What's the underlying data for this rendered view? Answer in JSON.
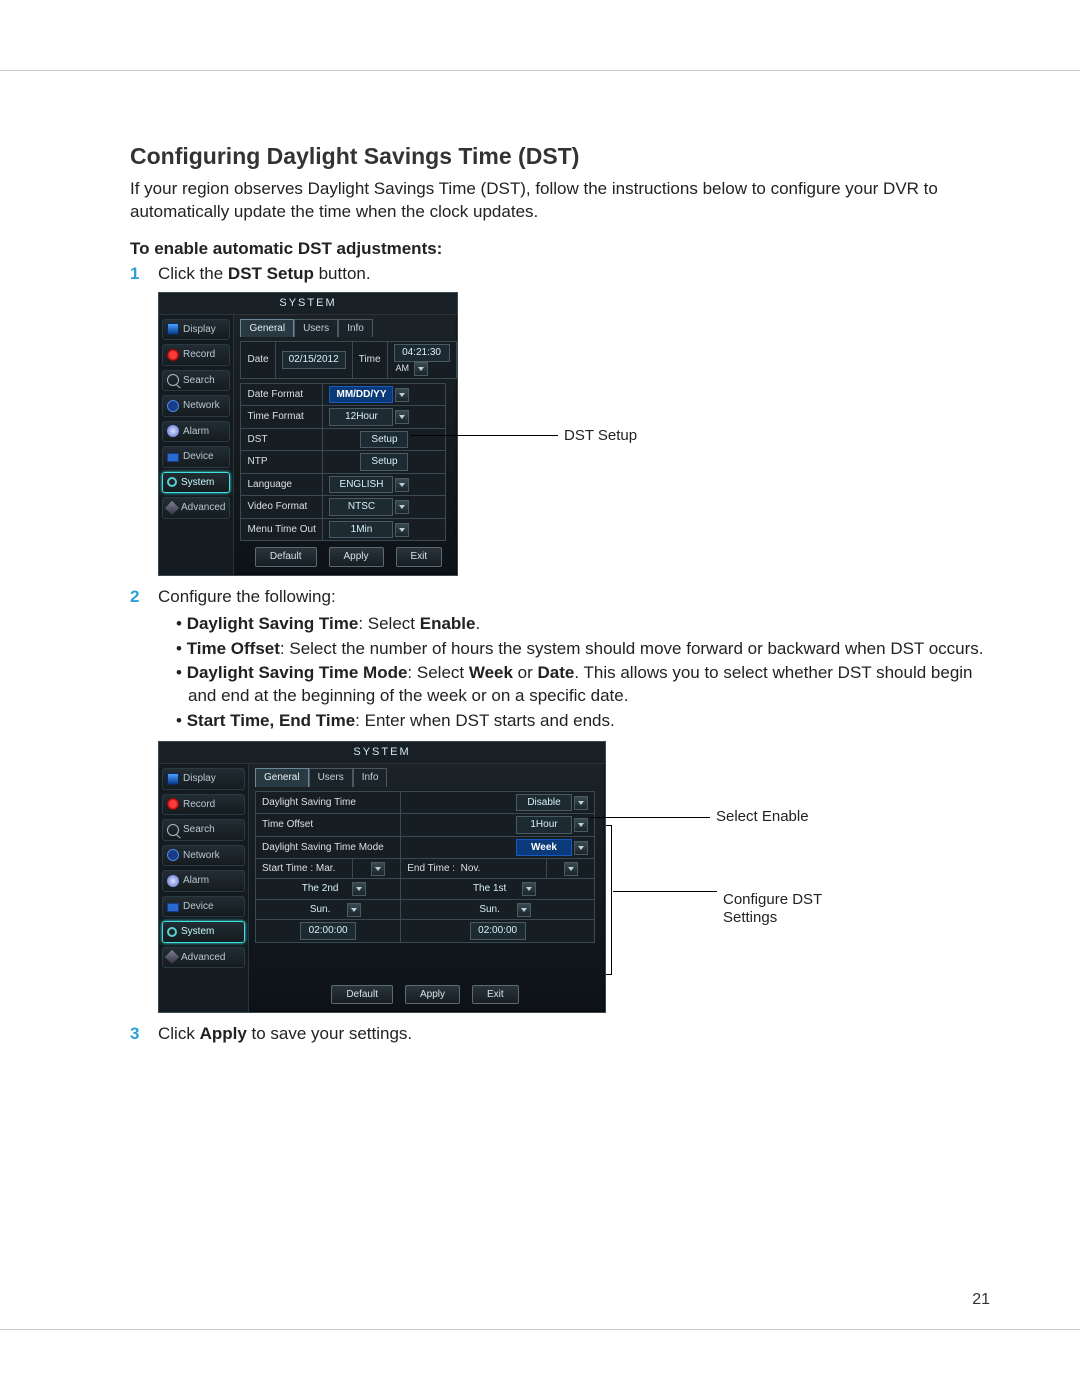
{
  "heading": "Configuring Daylight Savings Time (DST)",
  "intro": "If your region observes Daylight Savings Time (DST), follow the instructions below to configure your DVR to automatically update the time when the clock updates.",
  "subhead": "To enable automatic DST adjustments:",
  "steps": {
    "s1": {
      "num": "1",
      "text_prefix": "Click the ",
      "bold": "DST Setup",
      "text_suffix": " button."
    },
    "s2": {
      "num": "2",
      "lead": "Configure the following:",
      "b1": {
        "bold": "Daylight Saving Time",
        "rest": ": Select ",
        "bold2": "Enable",
        "rest2": "."
      },
      "b2": {
        "bold": "Time Offset",
        "rest": ": Select the number of hours the system should move forward or backward when DST occurs."
      },
      "b3": {
        "bold": "Daylight Saving Time Mode",
        "rest": ": Select ",
        "bold2": "Week",
        "rest2": " or ",
        "bold3": "Date",
        "rest3": ". This allows you to select whether DST should begin and end at the beginning of the week or on a specific date."
      },
      "b4": {
        "bold": "Start Time, End Time",
        "rest": ": Enter when DST starts and ends."
      }
    },
    "s3": {
      "num": "3",
      "text_prefix": "Click ",
      "bold": "Apply",
      "text_suffix": " to save your settings."
    }
  },
  "callouts": {
    "dst_setup": "DST Setup",
    "select_enable": "Select Enable",
    "configure_dst": "Configure DST Settings"
  },
  "page_number": "21",
  "dvr_common": {
    "title": "SYSTEM",
    "sidenav": [
      "Display",
      "Record",
      "Search",
      "Network",
      "Alarm",
      "Device",
      "System",
      "Advanced"
    ],
    "tabs": [
      "General",
      "Users",
      "Info"
    ],
    "buttons": {
      "default": "Default",
      "apply": "Apply",
      "exit": "Exit"
    }
  },
  "dvr1": {
    "date_label": "Date",
    "date_val": "02/15/2012",
    "time_label": "Time",
    "time_val": "04:21:30",
    "ampm": "AM",
    "rows": {
      "date_format": {
        "label": "Date Format",
        "val": "MM/DD/YY"
      },
      "time_format": {
        "label": "Time Format",
        "val": "12Hour"
      },
      "dst": {
        "label": "DST",
        "val": "Setup"
      },
      "ntp": {
        "label": "NTP",
        "val": "Setup"
      },
      "language": {
        "label": "Language",
        "val": "ENGLISH"
      },
      "video_format": {
        "label": "Video Format",
        "val": "NTSC"
      },
      "menu_timeout": {
        "label": "Menu Time Out",
        "val": "1Min"
      }
    }
  },
  "dvr2": {
    "rows": {
      "dst_enable": {
        "label": "Daylight Saving Time",
        "val": "Disable"
      },
      "offset": {
        "label": "Time Offset",
        "val": "1Hour"
      },
      "mode": {
        "label": "Daylight Saving Time Mode",
        "val": "Week"
      }
    },
    "start": {
      "label": "Start Time :",
      "month": "Mar.",
      "ordinal": "The 2nd",
      "day": "Sun.",
      "time": "02:00:00"
    },
    "end": {
      "label": "End Time :",
      "month": "Nov.",
      "ordinal": "The 1st",
      "day": "Sun.",
      "time": "02:00:00"
    }
  }
}
